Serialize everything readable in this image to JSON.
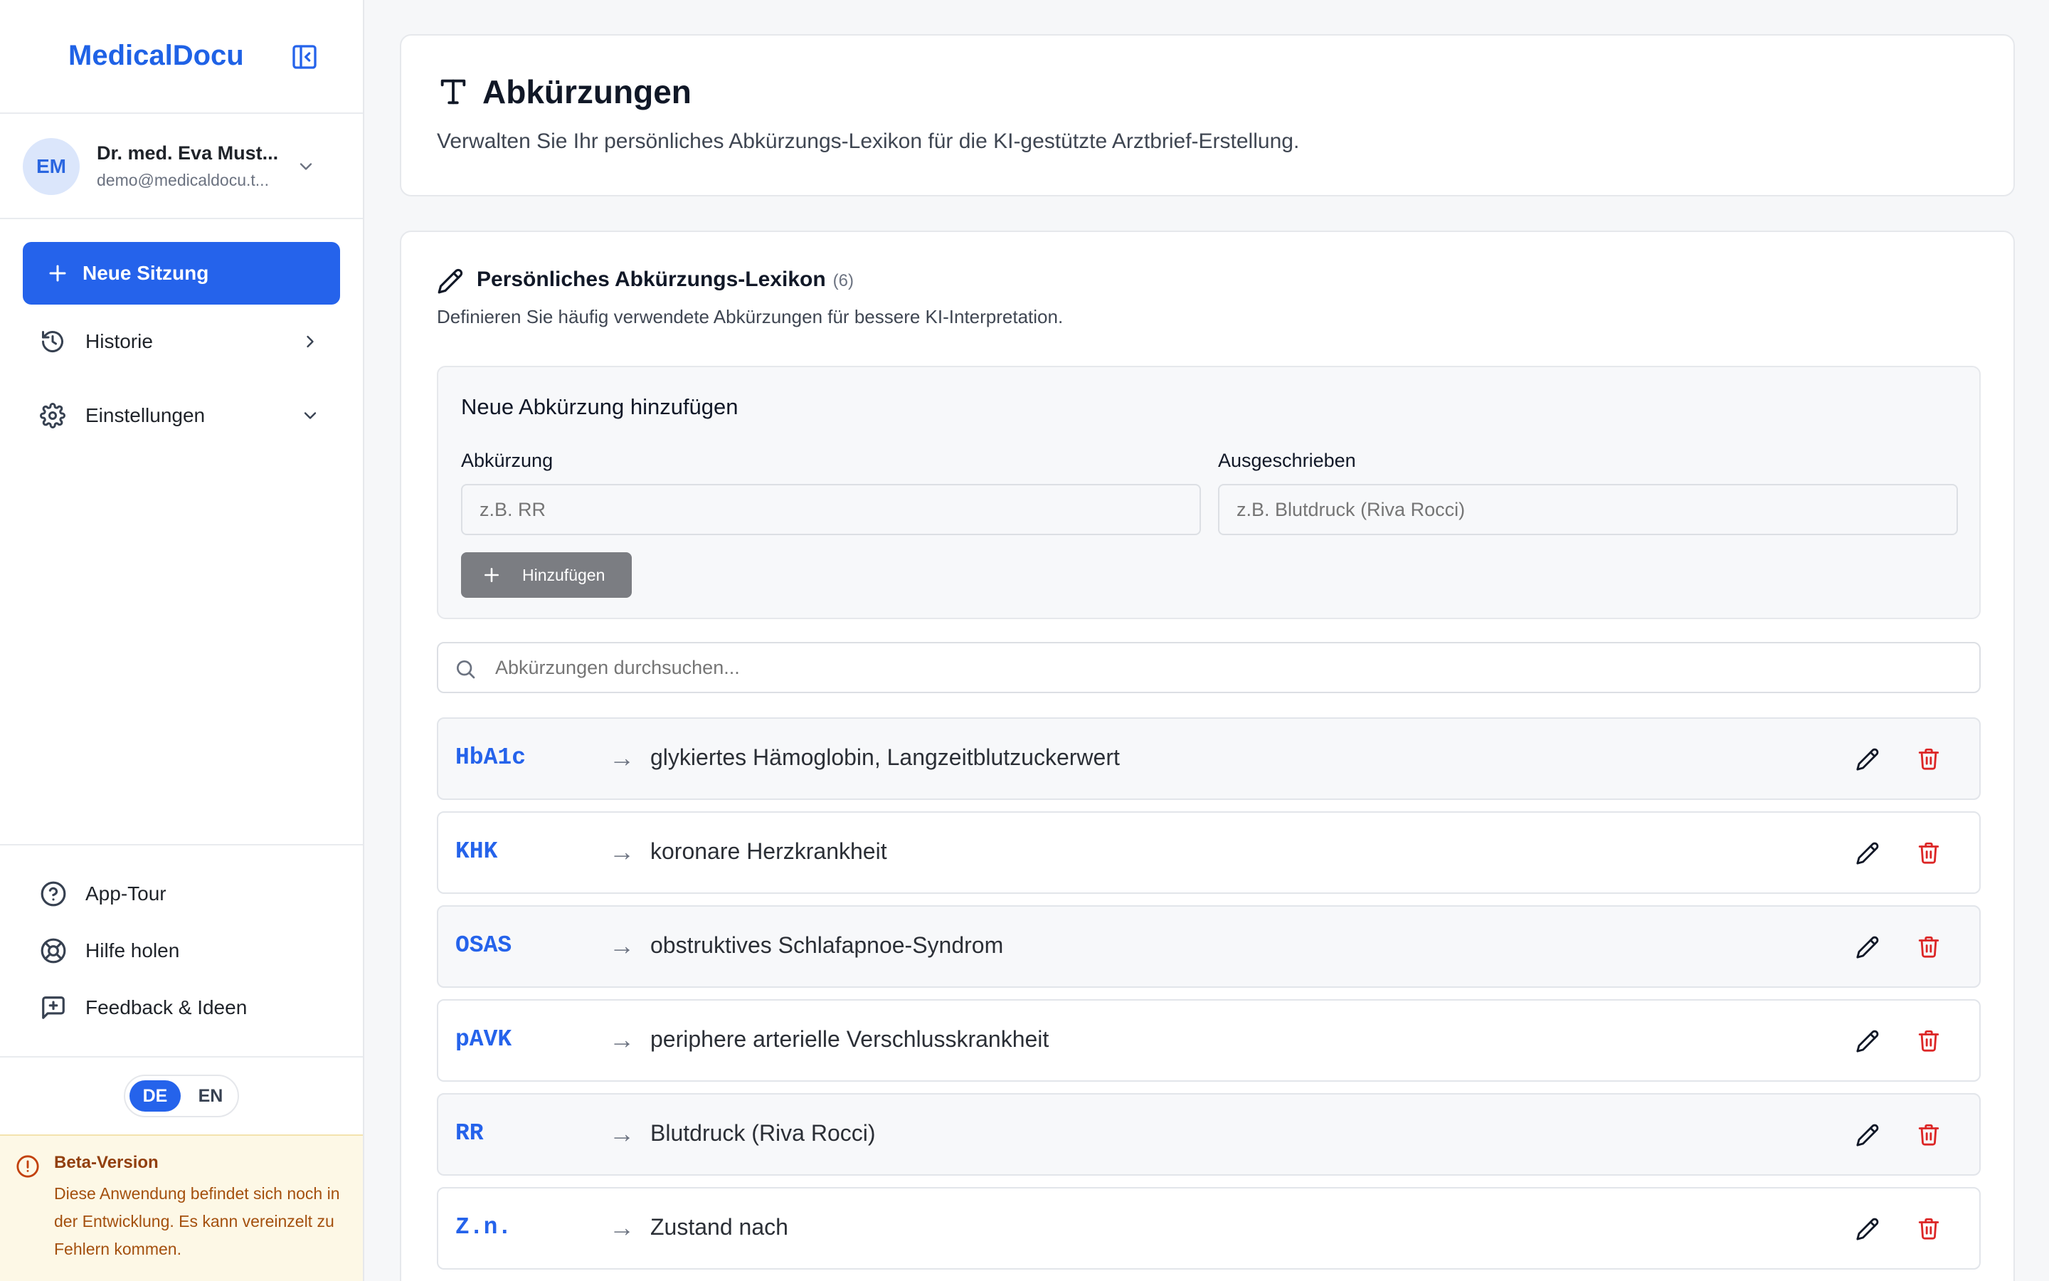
{
  "app": {
    "brand": "MedicalDocu"
  },
  "user": {
    "initials": "EM",
    "name": "Dr. med. Eva Must...",
    "email": "demo@medicaldocu.t..."
  },
  "sidebar": {
    "new_session": "Neue Sitzung",
    "items": [
      {
        "label": "Historie",
        "icon": "history-icon"
      },
      {
        "label": "Einstellungen",
        "icon": "gear-icon"
      }
    ],
    "bottom": [
      {
        "label": "App-Tour",
        "icon": "help-circle-icon"
      },
      {
        "label": "Hilfe holen",
        "icon": "lifebuoy-icon"
      },
      {
        "label": "Feedback & Ideen",
        "icon": "message-plus-icon"
      }
    ],
    "lang": {
      "de": "DE",
      "en": "EN",
      "active": "DE"
    },
    "beta": {
      "title": "Beta-Version",
      "text": "Diese Anwendung befindet sich noch in der Entwicklung. Es kann vereinzelt zu Fehlern kommen."
    }
  },
  "header": {
    "title": "Abkürzungen",
    "subtitle": "Verwalten Sie Ihr persönliches Abkürzungs-Lexikon für die KI-gestützte Arztbrief-Erstellung."
  },
  "lexicon": {
    "title": "Persönliches Abkürzungs-Lexikon",
    "count": "(6)",
    "subtitle": "Definieren Sie häufig verwendete Abkürzungen für bessere KI-Interpretation.",
    "add": {
      "title": "Neue Abkürzung hinzufügen",
      "abbr_label": "Abkürzung",
      "abbr_placeholder": "z.B. RR",
      "full_label": "Ausgeschrieben",
      "full_placeholder": "z.B. Blutdruck (Riva Rocci)",
      "button": "Hinzufügen"
    },
    "search_placeholder": "Abkürzungen durchsuchen...",
    "arrow": "→",
    "entries": [
      {
        "abbr": "HbA1c",
        "full": "glykiertes Hämoglobin, Langzeitblutzuckerwert"
      },
      {
        "abbr": "KHK",
        "full": "koronare Herzkrankheit"
      },
      {
        "abbr": "OSAS",
        "full": "obstruktives Schlafapnoe-Syndrom"
      },
      {
        "abbr": "pAVK",
        "full": "periphere arterielle Verschlusskrankheit"
      },
      {
        "abbr": "RR",
        "full": "Blutdruck (Riva Rocci)"
      },
      {
        "abbr": "Z.n.",
        "full": "Zustand nach"
      }
    ]
  },
  "colors": {
    "accent": "#2563eb",
    "danger": "#dc2626",
    "beta_bg": "#fdf8e6",
    "beta_text": "#92400e"
  }
}
